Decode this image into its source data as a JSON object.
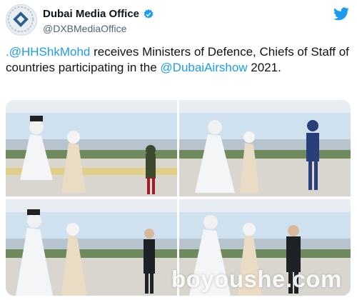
{
  "account": {
    "display_name": "Dubai Media Office",
    "handle": "@DXBMediaOffice",
    "verified": true
  },
  "icons": {
    "verified": "verified-badge-icon",
    "brand": "twitter-bird-icon",
    "avatar_logo": "dubai-media-office-logo"
  },
  "colors": {
    "link": "#1d9bf0",
    "verified": "#1d9bf0",
    "text": "#0f1419",
    "secondary": "#536471"
  },
  "tweet": {
    "mention": ".@HHShkMohd",
    "text_1": " receives Ministers of Defence, Chiefs of Staff of countries participating in the ",
    "hashtag_link": "@DubaiAirshow",
    "text_2": " 2021."
  },
  "photos": [
    {
      "label": "photo-1"
    },
    {
      "label": "photo-2"
    },
    {
      "label": "photo-3"
    },
    {
      "label": "photo-4"
    }
  ],
  "watermark": "boyoushe.com"
}
